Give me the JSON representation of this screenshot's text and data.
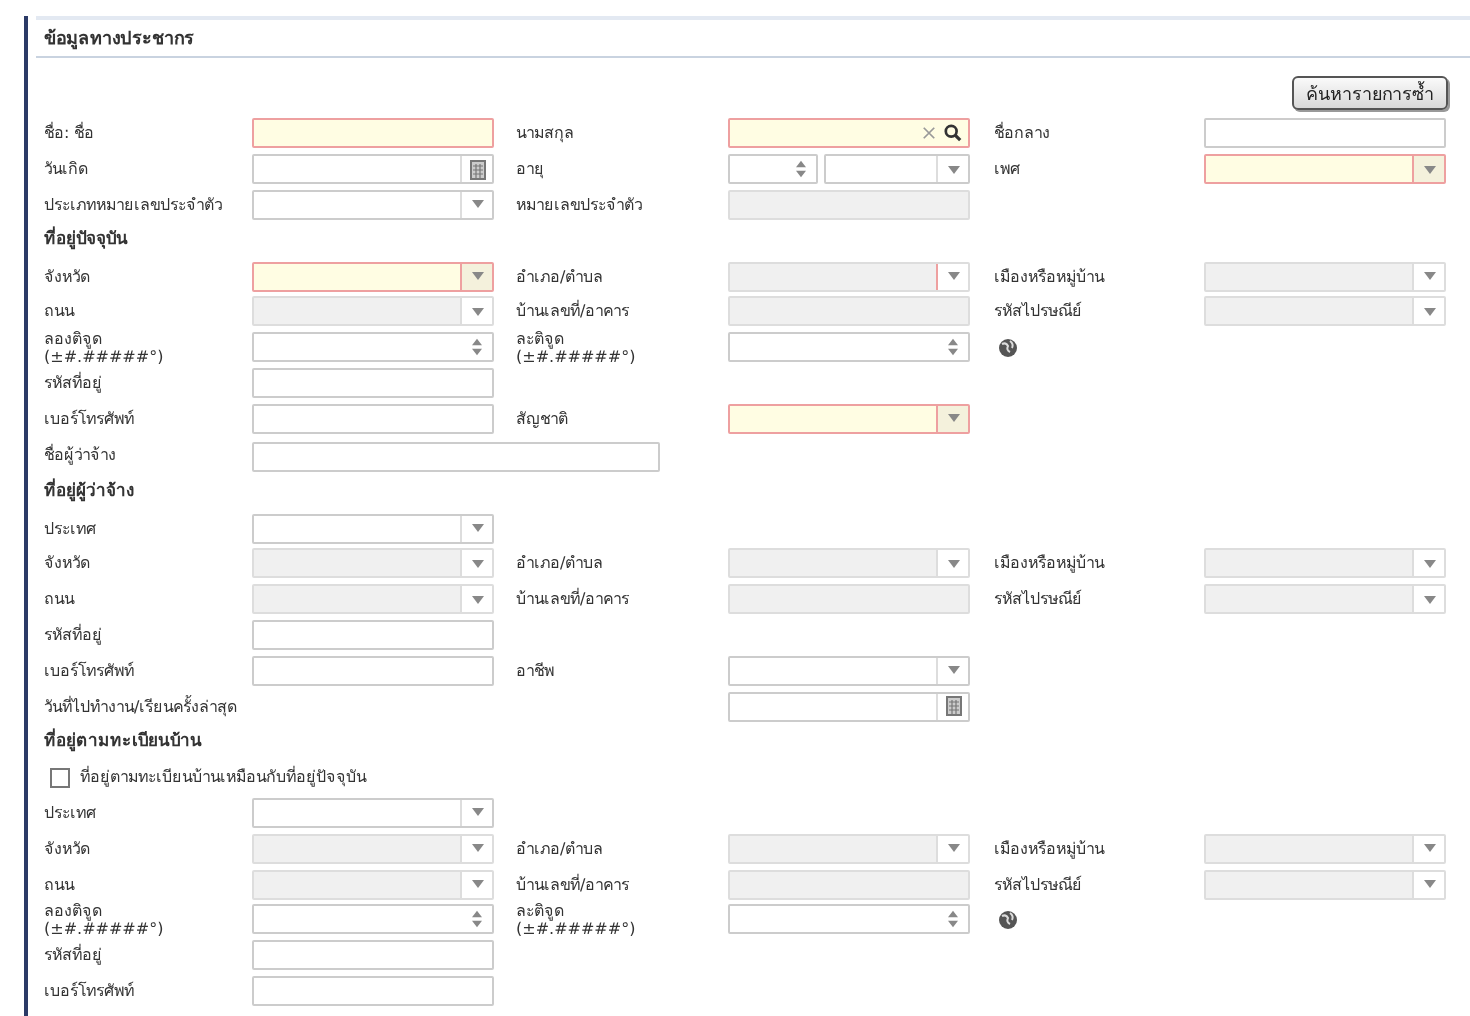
{
  "title": "ข้อมูลทางประชากร",
  "search_duplicates_button": "ค้นหารายการซ้ำ",
  "rows": [
    {
      "items": [
        {
          "kind": "label",
          "text": "ชื่อ: ชื่อ"
        },
        {
          "kind": "text",
          "required": true,
          "disabled": false
        },
        {
          "kind": "label",
          "text": "นามสกุล"
        },
        {
          "kind": "search",
          "required": true,
          "disabled": false
        },
        {
          "kind": "label",
          "text": "ชื่อกลาง"
        },
        {
          "kind": "text",
          "required": false,
          "disabled": false
        }
      ]
    },
    {
      "items": [
        {
          "kind": "label",
          "text": "วันเกิด"
        },
        {
          "kind": "date",
          "required": false,
          "disabled": false
        },
        {
          "kind": "label",
          "text": "อายุ"
        },
        {
          "kind": "age",
          "required": false,
          "disabled": false
        },
        {
          "kind": "label",
          "text": "เพศ"
        },
        {
          "kind": "select",
          "required": true,
          "disabled": false
        }
      ]
    },
    {
      "items": [
        {
          "kind": "label",
          "text": "ประเภทหมายเลขประจำตัว"
        },
        {
          "kind": "select",
          "required": false,
          "disabled": false
        },
        {
          "kind": "label",
          "text": "หมายเลขประจำตัว"
        },
        {
          "kind": "text",
          "required": false,
          "disabled": true
        }
      ]
    },
    {
      "items": [
        {
          "kind": "heading",
          "text": "ที่อยู่ปัจจุบัน"
        }
      ]
    },
    {
      "items": [
        {
          "kind": "label",
          "text": "จังหวัด"
        },
        {
          "kind": "select",
          "required": true,
          "disabled": false
        },
        {
          "kind": "label",
          "text": "อำเภอ/ตำบล"
        },
        {
          "kind": "select",
          "required": true,
          "disabled": true
        },
        {
          "kind": "label",
          "text": "เมืองหรือหมู่บ้าน"
        },
        {
          "kind": "select",
          "required": false,
          "disabled": true
        }
      ]
    },
    {
      "items": [
        {
          "kind": "label",
          "text": "ถนน"
        },
        {
          "kind": "select",
          "required": false,
          "disabled": true
        },
        {
          "kind": "label",
          "text": "บ้านเลขที่/อาคาร"
        },
        {
          "kind": "text",
          "required": false,
          "disabled": true
        },
        {
          "kind": "label",
          "text": "รหัสไปรษณีย์"
        },
        {
          "kind": "select",
          "required": false,
          "disabled": true
        }
      ]
    },
    {
      "items": [
        {
          "kind": "label",
          "text": "ลองติจูด\n(±#.#####°)"
        },
        {
          "kind": "spin",
          "required": false,
          "disabled": false
        },
        {
          "kind": "label",
          "text": "ละติจูด\n(±#.#####°)"
        },
        {
          "kind": "spin",
          "required": false,
          "disabled": false
        },
        {
          "kind": "globe"
        }
      ]
    },
    {
      "items": [
        {
          "kind": "label",
          "text": "รหัสที่อยู่"
        },
        {
          "kind": "text",
          "required": false,
          "disabled": false
        }
      ]
    },
    {
      "items": [
        {
          "kind": "label",
          "text": "เบอร์โทรศัพท์"
        },
        {
          "kind": "text",
          "required": false,
          "disabled": false
        },
        {
          "kind": "label",
          "text": "สัญชาติ"
        },
        {
          "kind": "select",
          "required": true,
          "disabled": false
        }
      ]
    },
    {
      "items": [
        {
          "kind": "label",
          "text": "ชื่อผู้ว่าจ้าง"
        },
        {
          "kind": "wide_text",
          "required": false,
          "disabled": false
        }
      ]
    },
    {
      "items": [
        {
          "kind": "heading",
          "text": "ที่อยู่ผู้ว่าจ้าง"
        }
      ]
    },
    {
      "items": [
        {
          "kind": "label",
          "text": "ประเทศ"
        },
        {
          "kind": "select",
          "required": false,
          "disabled": false
        }
      ]
    },
    {
      "items": [
        {
          "kind": "label",
          "text": "จังหวัด"
        },
        {
          "kind": "select",
          "required": false,
          "disabled": true
        },
        {
          "kind": "label",
          "text": "อำเภอ/ตำบล"
        },
        {
          "kind": "select",
          "required": false,
          "disabled": true
        },
        {
          "kind": "label",
          "text": "เมืองหรือหมู่บ้าน"
        },
        {
          "kind": "select",
          "required": false,
          "disabled": true
        }
      ]
    },
    {
      "items": [
        {
          "kind": "label",
          "text": "ถนน"
        },
        {
          "kind": "select",
          "required": false,
          "disabled": true
        },
        {
          "kind": "label",
          "text": "บ้านเลขที่/อาคาร"
        },
        {
          "kind": "text",
          "required": false,
          "disabled": true
        },
        {
          "kind": "label",
          "text": "รหัสไปรษณีย์"
        },
        {
          "kind": "select",
          "required": false,
          "disabled": true
        }
      ]
    },
    {
      "items": [
        {
          "kind": "label",
          "text": "รหัสที่อยู่"
        },
        {
          "kind": "text",
          "required": false,
          "disabled": false
        }
      ]
    },
    {
      "items": [
        {
          "kind": "label",
          "text": "เบอร์โทรศัพท์"
        },
        {
          "kind": "text",
          "required": false,
          "disabled": false
        },
        {
          "kind": "label",
          "text": "อาชีพ"
        },
        {
          "kind": "select",
          "required": false,
          "disabled": false
        }
      ]
    },
    {
      "items": [
        {
          "kind": "wide_label",
          "text": "วันที่ไปทำงาน/เรียนครั้งล่าสุด"
        },
        {
          "kind": "date",
          "required": false,
          "disabled": false
        }
      ]
    },
    {
      "items": [
        {
          "kind": "heading",
          "text": "ที่อยู่ตามทะเบียนบ้าน"
        }
      ]
    },
    {
      "items": [
        {
          "kind": "checkbox",
          "text": "ที่อยู่ตามทะเบียนบ้านเหมือนกับที่อยู่ปัจจุบัน",
          "checked": false
        }
      ]
    },
    {
      "items": [
        {
          "kind": "label",
          "text": "ประเทศ"
        },
        {
          "kind": "select",
          "required": false,
          "disabled": false
        }
      ]
    },
    {
      "items": [
        {
          "kind": "label",
          "text": "จังหวัด"
        },
        {
          "kind": "select",
          "required": false,
          "disabled": true
        },
        {
          "kind": "label",
          "text": "อำเภอ/ตำบล"
        },
        {
          "kind": "select",
          "required": false,
          "disabled": true
        },
        {
          "kind": "label",
          "text": "เมืองหรือหมู่บ้าน"
        },
        {
          "kind": "select",
          "required": false,
          "disabled": true
        }
      ]
    },
    {
      "items": [
        {
          "kind": "label",
          "text": "ถนน"
        },
        {
          "kind": "select",
          "required": false,
          "disabled": true
        },
        {
          "kind": "label",
          "text": "บ้านเลขที่/อาคาร"
        },
        {
          "kind": "text",
          "required": false,
          "disabled": true
        },
        {
          "kind": "label",
          "text": "รหัสไปรษณีย์"
        },
        {
          "kind": "select",
          "required": false,
          "disabled": true
        }
      ]
    },
    {
      "items": [
        {
          "kind": "label",
          "text": "ลองติจูด\n(±#.#####°)"
        },
        {
          "kind": "spin",
          "required": false,
          "disabled": false
        },
        {
          "kind": "label",
          "text": "ละติจูด\n(±#.#####°)"
        },
        {
          "kind": "spin",
          "required": false,
          "disabled": false
        },
        {
          "kind": "globe"
        }
      ]
    },
    {
      "items": [
        {
          "kind": "label",
          "text": "รหัสที่อยู่"
        },
        {
          "kind": "text",
          "required": false,
          "disabled": false
        }
      ]
    },
    {
      "items": [
        {
          "kind": "label",
          "text": "เบอร์โทรศัพท์"
        },
        {
          "kind": "text",
          "required": false,
          "disabled": false
        }
      ]
    }
  ]
}
